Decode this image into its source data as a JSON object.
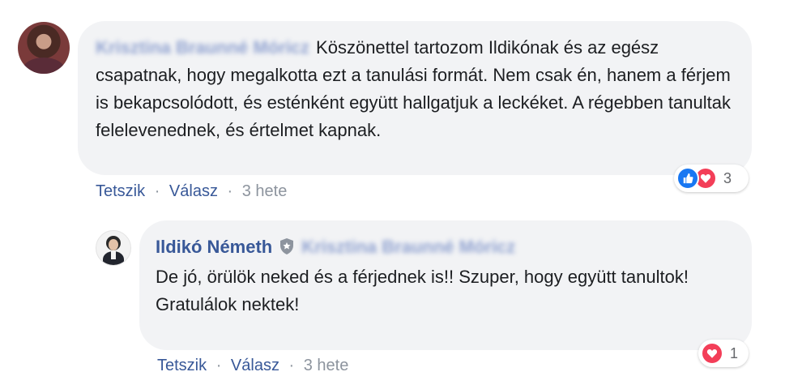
{
  "comment": {
    "author_name": "Krisztina Braunné Móricz",
    "text": "Köszönettel tartozom Ildikónak és az egész csapatnak, hogy megalkotta ezt a tanulási formát. Nem csak én, hanem a férjem is bekapcsolódott, és esténként együtt hallgatjuk a leckéket. A régebben tanultak felelevenednek, és értelmet kapnak.",
    "actions": {
      "like": "Tetszik",
      "sep1": "·",
      "reply": "Válasz",
      "sep2": "·",
      "time": "3 hete"
    },
    "reactions": {
      "icons": [
        "like-icon",
        "love-icon"
      ],
      "count": "3"
    }
  },
  "reply": {
    "author_name": "Ildikó Németh",
    "badge_icon": "admin-shield-icon",
    "mention": "Krisztina Braunné Móricz",
    "text": "De jó, örülök neked és a férjednek is!! Szuper, hogy együtt tanultok!\nGratulálok nektek!",
    "actions": {
      "like": "Tetszik",
      "sep1": "·",
      "reply": "Válasz",
      "sep2": "·",
      "time": "3 hete"
    },
    "reactions": {
      "icons": [
        "love-icon"
      ],
      "count": "1"
    }
  },
  "colors": {
    "link": "#385898",
    "bubble": "#f2f3f5",
    "muted": "#8d949e",
    "like": "#1877f2",
    "love": "#f33e58"
  }
}
